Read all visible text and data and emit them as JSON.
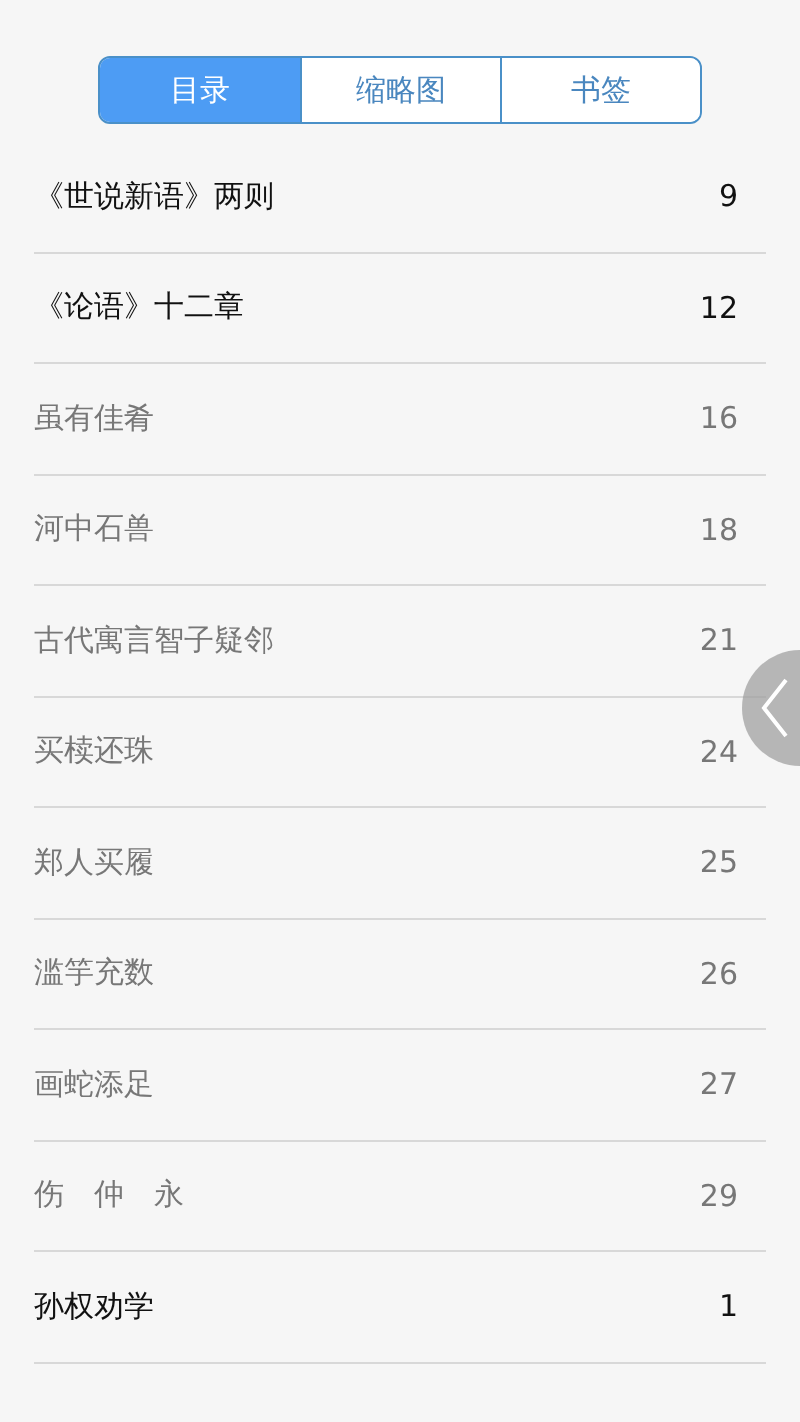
{
  "tabs": [
    {
      "label": "目录",
      "selected": true
    },
    {
      "label": "缩略图",
      "selected": false
    },
    {
      "label": "书签",
      "selected": false
    }
  ],
  "contents": [
    {
      "title": "《世说新语》两则",
      "page": "9",
      "kind": "dark"
    },
    {
      "title": "《论语》十二章",
      "page": "12",
      "kind": "dark"
    },
    {
      "title": "虽有佳肴",
      "page": "16",
      "kind": "light"
    },
    {
      "title": "河中石兽",
      "page": "18",
      "kind": "light"
    },
    {
      "title": "古代寓言智子疑邻",
      "page": "21",
      "kind": "light"
    },
    {
      "title": "买椟还珠",
      "page": "24",
      "kind": "light"
    },
    {
      "title": "郑人买履",
      "page": "25",
      "kind": "light"
    },
    {
      "title": "滥竽充数",
      "page": "26",
      "kind": "light"
    },
    {
      "title": "画蛇添足",
      "page": "27",
      "kind": "light"
    },
    {
      "title": "伤　仲　永",
      "page": "29",
      "kind": "light"
    },
    {
      "title": "孙权劝学",
      "page": "1",
      "kind": "dark"
    }
  ]
}
